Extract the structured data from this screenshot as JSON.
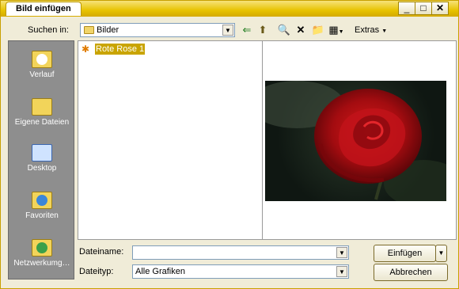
{
  "window": {
    "title": "Bild einfügen",
    "minimize": "_",
    "maximize": "□",
    "close": "✕"
  },
  "lookin": {
    "label": "Suchen in:",
    "value": "Bilder"
  },
  "toolbar": {
    "back_icon": "⇐",
    "up_icon": "⬆",
    "search_web_icon": "🔍",
    "delete_icon": "✕",
    "new_folder_icon": "📁",
    "views_icon": "▦",
    "extras_label": "Extras"
  },
  "places": [
    {
      "name": "Verlauf"
    },
    {
      "name": "Eigene Dateien"
    },
    {
      "name": "Desktop"
    },
    {
      "name": "Favoriten"
    },
    {
      "name": "Netzwerkumg…"
    }
  ],
  "files": [
    {
      "name": "Rote Rose 1",
      "selected": true
    }
  ],
  "filename": {
    "label": "Dateiname:",
    "value": ""
  },
  "filetype": {
    "label": "Dateityp:",
    "value": "Alle Grafiken"
  },
  "buttons": {
    "insert": "Einfügen",
    "cancel": "Abbrechen"
  },
  "colors": {
    "titlebar": "#e7c300",
    "selection": "#c9a400",
    "places_bg": "#8e8e8e"
  }
}
